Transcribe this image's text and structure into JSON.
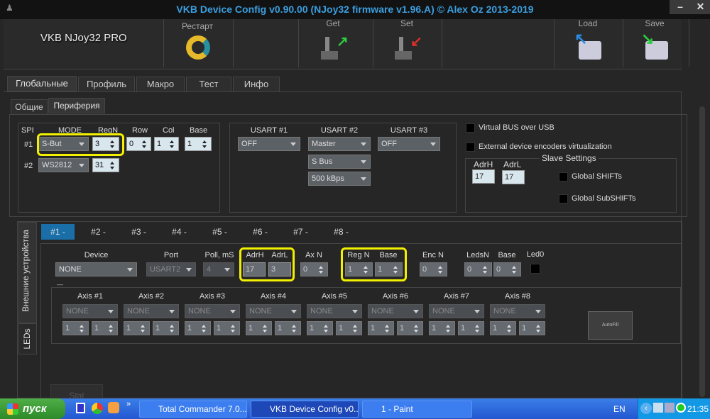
{
  "window": {
    "title": "VKB Device Config v0.90.00 (NJoy32 firmware v1.96.A) © Alex Oz 2013-2019",
    "minimize": "–",
    "close": "✕"
  },
  "header": {
    "device_name": "VKB NJoy32 PRO",
    "buttons": [
      {
        "label": "Рестарт",
        "icon": "restart-icon"
      },
      {
        "label": "Get",
        "icon": "joystick-get-icon"
      },
      {
        "label": "Set",
        "icon": "joystick-set-icon"
      },
      {
        "label": "Load",
        "icon": "hdd-load-icon"
      },
      {
        "label": "Save",
        "icon": "hdd-save-icon"
      }
    ]
  },
  "main_tabs": [
    {
      "label": "Глобальные",
      "active": true
    },
    {
      "label": "Профиль"
    },
    {
      "label": "Макро"
    },
    {
      "label": "Тест"
    },
    {
      "label": "Инфо"
    }
  ],
  "sub_tabs": [
    {
      "label": "Общие"
    },
    {
      "label": "Периферия",
      "active": true
    }
  ],
  "spi": {
    "headers": {
      "spi": "SPI",
      "mode": "MODE",
      "regn": "RegN",
      "row": "Row",
      "col": "Col",
      "base": "Base"
    },
    "rows": [
      {
        "label": "#1",
        "mode": "S-But",
        "regn": "3",
        "row": "0",
        "col": "1",
        "base": "1"
      },
      {
        "label": "#2",
        "mode": "WS2812",
        "regn": "31"
      }
    ]
  },
  "usart": {
    "headers": [
      "USART #1",
      "USART #2",
      "USART #3"
    ],
    "usart1": "OFF",
    "usart2": [
      "Master",
      "S Bus",
      "500 kBps"
    ],
    "usart3": "OFF"
  },
  "options": {
    "virtual_bus": "Virtual BUS over USB",
    "ext_encoders": "External device encoders virtualization"
  },
  "slave": {
    "title": "Slave Settings",
    "adrh_label": "AdrH",
    "adrl_label": "AdrL",
    "adrh": "17",
    "adrl": "17",
    "global_shifts": "Global SHIFTs",
    "global_subshifts": "Global SubSHIFTs"
  },
  "vertical_tabs": [
    {
      "label": "Внешние устройства",
      "active": true
    },
    {
      "label": "LEDs"
    }
  ],
  "device_tabs": [
    "#1 -",
    "#2 -",
    "#3 -",
    "#4 -",
    "#5 -",
    "#6 -",
    "#7 -",
    "#8 -"
  ],
  "device": {
    "labels": {
      "device": "Device",
      "port": "Port",
      "poll": "Poll, mS",
      "adrh": "AdrH",
      "adrl": "AdrL",
      "axn": "Ax N",
      "regn": "Reg N",
      "base": "Base",
      "encn": "Enc N",
      "ledsn": "LedsN",
      "base2": "Base",
      "led0": "Led0"
    },
    "values": {
      "device": "NONE",
      "port": "USART2",
      "poll": "4",
      "adrh": "17",
      "adrl": "3",
      "axn": "0",
      "regn": "1",
      "base": "1",
      "encn": "0",
      "ledsn": "0",
      "base2": "0"
    },
    "separator": "—"
  },
  "axes": [
    {
      "label": "Axis #1",
      "mode": "NONE",
      "a": "1",
      "b": "1"
    },
    {
      "label": "Axis #2",
      "mode": "NONE",
      "a": "1",
      "b": "1"
    },
    {
      "label": "Axis #3",
      "mode": "NONE",
      "a": "1",
      "b": "1"
    },
    {
      "label": "Axis #4",
      "mode": "NONE",
      "a": "1",
      "b": "1"
    },
    {
      "label": "Axis #5",
      "mode": "NONE",
      "a": "1",
      "b": "1"
    },
    {
      "label": "Axis #6",
      "mode": "NONE",
      "a": "1",
      "b": "1"
    },
    {
      "label": "Axis #7",
      "mode": "NONE",
      "a": "1",
      "b": "1"
    },
    {
      "label": "Axis #8",
      "mode": "NONE",
      "a": "1",
      "b": "1"
    }
  ],
  "autofill": "AutoFill",
  "stat": "Stat",
  "taskbar": {
    "start": "пуск",
    "tasks": [
      "Total Commander 7.0...",
      "VKB Device Config v0...",
      "1 - Paint"
    ],
    "lang": "EN",
    "clock": "21:35",
    "quicklaunch_more": "»"
  },
  "colors": {
    "accent": "#3b9fe0",
    "active_device_tab": "#1a6fa8",
    "highlight": "#f2f000"
  }
}
